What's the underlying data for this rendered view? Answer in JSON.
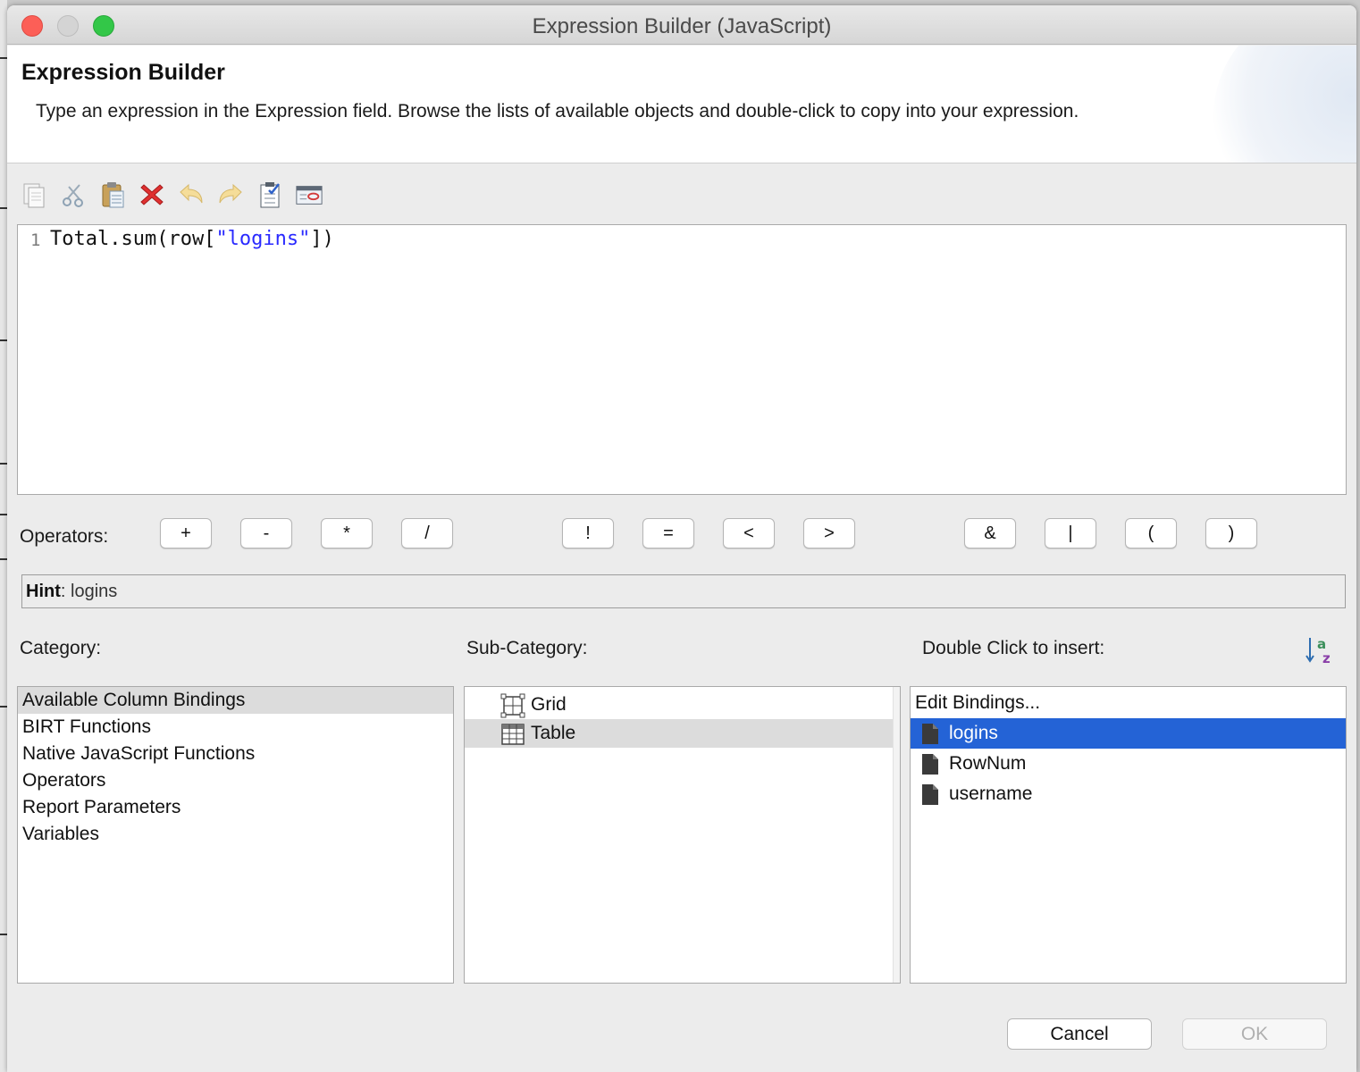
{
  "window": {
    "title": "Expression Builder (JavaScript)"
  },
  "header": {
    "title": "Expression Builder",
    "description": "Type an expression in the Expression field. Browse the lists of available objects and double-click to copy into your expression."
  },
  "toolbar": {
    "buttons": [
      "copy-icon",
      "cut-icon",
      "paste-icon",
      "delete-icon",
      "undo-icon",
      "redo-icon",
      "validate-icon",
      "calculate-icon"
    ]
  },
  "editor": {
    "line_number": "1",
    "code_prefix": "Total.sum(row[",
    "code_string": "\"logins\"",
    "code_suffix": "])"
  },
  "operators": {
    "label": "Operators:",
    "buttons": [
      "+",
      "-",
      "*",
      "/",
      "!",
      "=",
      "<",
      ">",
      "&",
      "|",
      "(",
      ")"
    ]
  },
  "hint": {
    "label": "Hint",
    "value": ": logins"
  },
  "category": {
    "label": "Category:",
    "items": [
      "Available Column Bindings",
      "BIRT Functions",
      "Native JavaScript Functions",
      "Operators",
      "Report Parameters",
      "Variables"
    ],
    "selected_index": 0
  },
  "subcategory": {
    "label": "Sub-Category:",
    "items": [
      "Grid",
      "Table"
    ],
    "selected_index": 1
  },
  "insert": {
    "label": "Double Click to insert:",
    "edit_bindings": "Edit Bindings...",
    "items": [
      "logins",
      "RowNum",
      "username"
    ],
    "selected_index": 0
  },
  "buttons": {
    "cancel": "Cancel",
    "ok": "OK"
  },
  "colors": {
    "selection_blue": "#2463d6",
    "selection_gray": "#dcdcdc",
    "string_literal": "#2a2aff"
  }
}
